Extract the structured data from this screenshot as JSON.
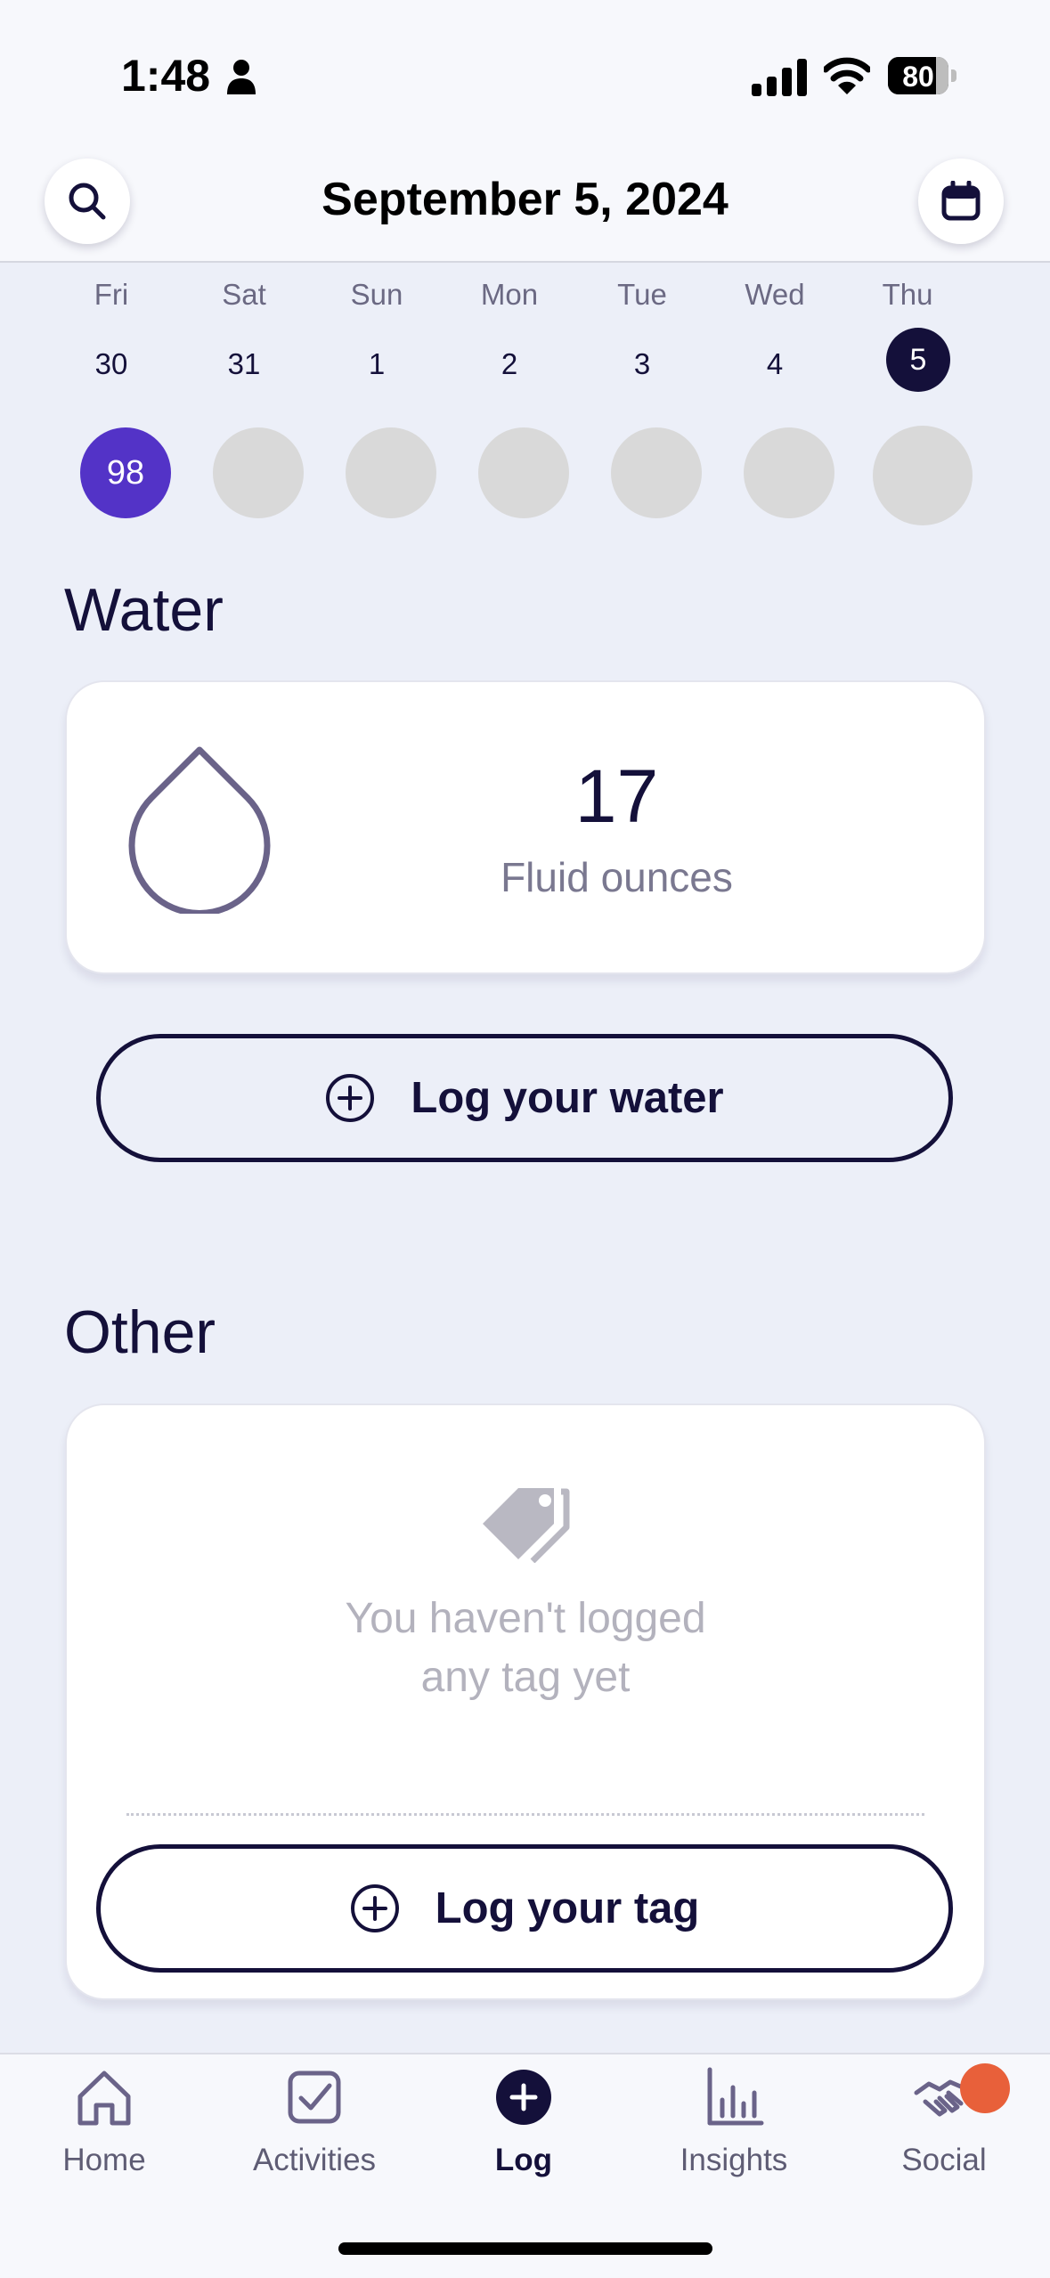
{
  "status_bar": {
    "time": "1:48",
    "battery": "80",
    "battery_level": 0.8
  },
  "header": {
    "title": "September 5, 2024",
    "search_icon": "search-icon",
    "calendar_icon": "calendar-icon"
  },
  "week": {
    "days": [
      {
        "name": "Fri",
        "num": "30",
        "score": "98",
        "selected": false,
        "has_score": true
      },
      {
        "name": "Sat",
        "num": "31",
        "score": "",
        "selected": false,
        "has_score": false
      },
      {
        "name": "Sun",
        "num": "1",
        "score": "",
        "selected": false,
        "has_score": false
      },
      {
        "name": "Mon",
        "num": "2",
        "score": "",
        "selected": false,
        "has_score": false
      },
      {
        "name": "Tue",
        "num": "3",
        "score": "",
        "selected": false,
        "has_score": false
      },
      {
        "name": "Wed",
        "num": "4",
        "score": "",
        "selected": false,
        "has_score": false
      },
      {
        "name": "Thu",
        "num": "5",
        "score": "",
        "selected": true,
        "has_score": false
      }
    ]
  },
  "water": {
    "title": "Water",
    "value": "17",
    "unit": "Fluid ounces",
    "button_label": "Log your water",
    "icon": "water-drop-icon"
  },
  "other": {
    "title": "Other",
    "empty_message_line1": "You haven't logged",
    "empty_message_line2": "any tag yet",
    "button_label": "Log your tag",
    "icon": "tag-icon"
  },
  "nav": {
    "items": [
      {
        "label": "Home",
        "icon": "home-icon",
        "active": false
      },
      {
        "label": "Activities",
        "icon": "checkbox-icon",
        "active": false
      },
      {
        "label": "Log",
        "icon": "plus-circle-icon",
        "active": true
      },
      {
        "label": "Insights",
        "icon": "bar-chart-icon",
        "active": false
      },
      {
        "label": "Social",
        "icon": "handshake-icon",
        "active": false
      }
    ]
  },
  "colors": {
    "accent": "#5333c7",
    "ink": "#14103a",
    "badge": "#e8603a",
    "background": "#eceff8"
  }
}
